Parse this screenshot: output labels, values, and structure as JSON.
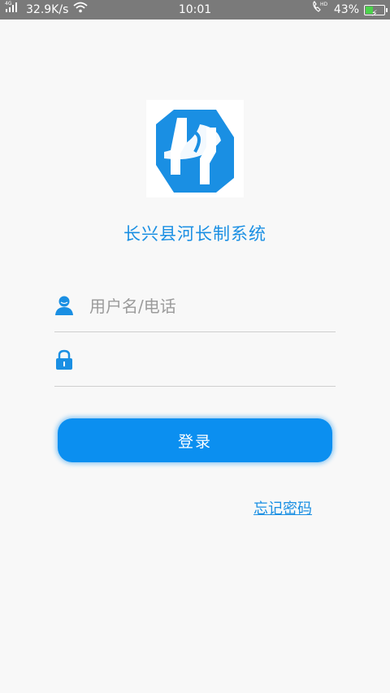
{
  "status_bar": {
    "network_type": "4G",
    "speed": "32.9K/s",
    "time": "10:01",
    "call_indicator": "HD",
    "battery_percent": "43%",
    "battery_level": 0.43,
    "icons": [
      "signal-icon",
      "wifi-icon",
      "hd-call-icon",
      "battery-icon"
    ]
  },
  "app": {
    "title": "长兴县河长制系统",
    "logo_color": "#1a8fe3"
  },
  "login_form": {
    "username_placeholder": "用户名/电话",
    "username_value": "",
    "password_placeholder": "",
    "password_value": "",
    "login_label": "登录",
    "forgot_label": "忘记密码"
  },
  "colors": {
    "accent": "#0b8ff0",
    "status_bar_bg": "#7a7a7a",
    "background": "#f8f8f8"
  }
}
